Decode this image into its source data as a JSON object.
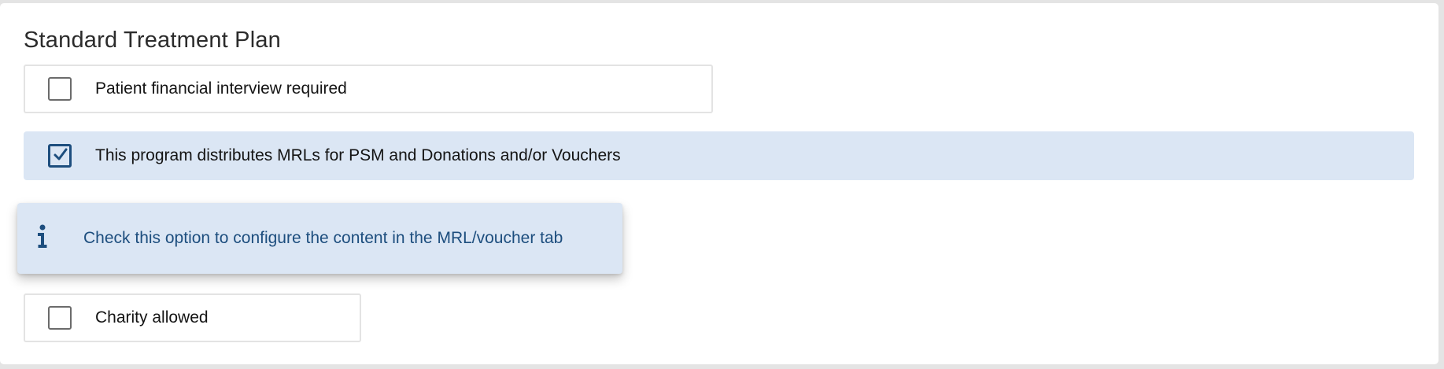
{
  "section": {
    "title": "Standard Treatment Plan"
  },
  "options": [
    {
      "label": "Patient financial interview required",
      "checked": false
    },
    {
      "label": "This program distributes MRLs for PSM and Donations and/or Vouchers",
      "checked": true
    },
    {
      "label": "Charity allowed",
      "checked": false
    }
  ],
  "tooltip": {
    "icon": "info-icon",
    "text": "Check this option to configure the content in the MRL/voucher tab"
  },
  "colors": {
    "accent": "#1d4e7e",
    "selected_background": "#dbe6f4",
    "checkbox_border": "#6b6b6b"
  }
}
